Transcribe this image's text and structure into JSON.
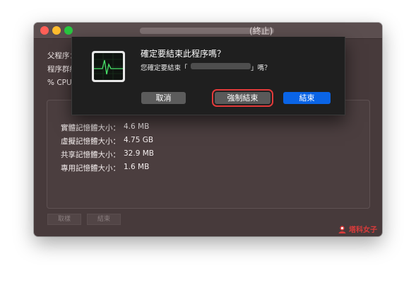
{
  "window": {
    "title_suffix": "(終止)",
    "info_labels": [
      "父程序：",
      "程序群組：",
      "% CPU："
    ]
  },
  "memory": [
    {
      "label": "實體記憶體大小：",
      "value": "4.6 MB"
    },
    {
      "label": "虛擬記憶體大小：",
      "value": "4.75 GB"
    },
    {
      "label": "共享記憶體大小：",
      "value": "32.9 MB"
    },
    {
      "label": "專用記憶體大小：",
      "value": "1.6 MB"
    }
  ],
  "bottom_buttons": {
    "sample": "取樣",
    "quit": "結束"
  },
  "dialog": {
    "title": "確定要結束此程序嗎？",
    "message_prefix": "您確定要結束「",
    "message_suffix": "」嗎？",
    "buttons": {
      "cancel": "取消",
      "force_quit": "強制結束",
      "quit": "結束"
    }
  },
  "watermark": {
    "text": "塔科女子"
  },
  "colors": {
    "window_bg": "#473a3b",
    "dialog_bg": "#1f1f1f",
    "primary_blue": "#0a64e6",
    "highlight_red": "#e33a3a"
  }
}
